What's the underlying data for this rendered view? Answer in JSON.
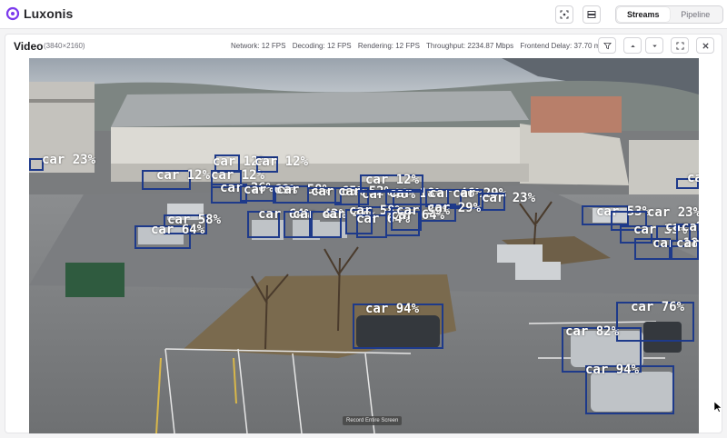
{
  "app": {
    "brand": "Luxonis"
  },
  "topbar": {
    "tabs": [
      {
        "label": "Streams",
        "active": true
      },
      {
        "label": "Pipeline",
        "active": false
      }
    ],
    "icons": [
      "screenshot-icon",
      "layout-icon"
    ]
  },
  "panel": {
    "title": "Video",
    "resolution": "(3840×2160)",
    "stats": {
      "network": "Network: 12 FPS",
      "decoding": "Decoding: 12 FPS",
      "rendering": "Rendering: 12 FPS",
      "throughput": "Throughput: 2234.87 Mbps",
      "frontend_delay": "Frontend Delay: 37.70 ms"
    },
    "buttons": [
      "filter-icon",
      "chevron-up-icon",
      "chevron-down-icon",
      "fullscreen-icon",
      "close-icon"
    ]
  },
  "video": {
    "tooltip": "Record Entire Screen",
    "box_color": "#1e3a8a",
    "labels": [
      "car 23%",
      "car 12%",
      "car 12%",
      "car 12%",
      "car 12%",
      "car 36%",
      "car 69%",
      "car 58%",
      "car 65%",
      "car 52%",
      "car 46%",
      "car 18%",
      "car 12%",
      "car 46%",
      "car 29%",
      "car 23%",
      "car 58%",
      "car 64%",
      "car 64%",
      "car 42%",
      "car 47%",
      "car 58%",
      "car 64%",
      "car 64%",
      "car 39%",
      "car 29%",
      "car 94%",
      "car 53%",
      "car 23%",
      "car 35%",
      "car 98%",
      "car 29%",
      "car 18%",
      "car 23%",
      "car 76%",
      "car 82%",
      "car 94%",
      "car"
    ]
  }
}
